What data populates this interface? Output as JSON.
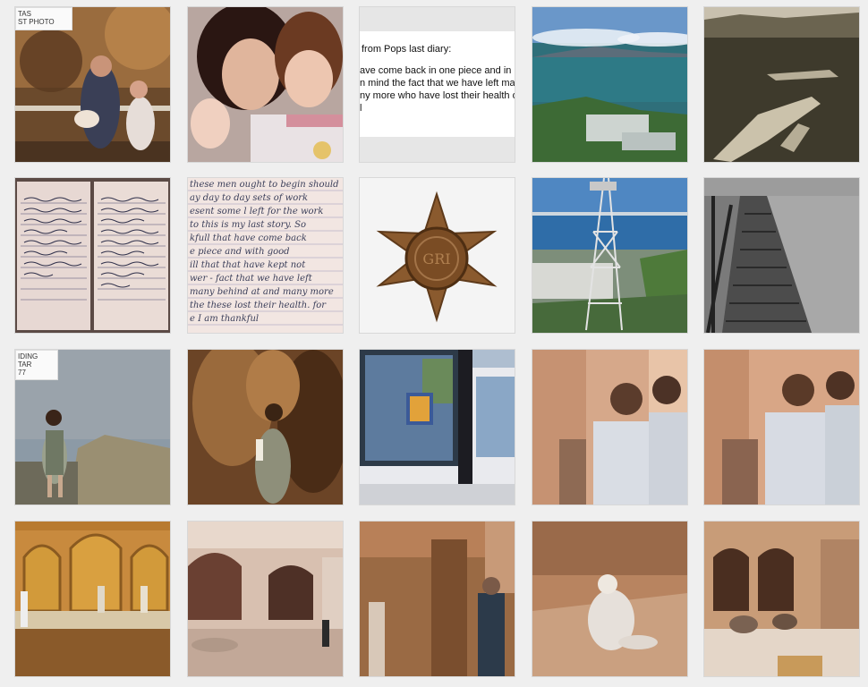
{
  "tiles": [
    {
      "name": "photo-family-garden",
      "note": "TAS\nST PHOTO"
    },
    {
      "name": "photo-mother-children"
    },
    {
      "name": "photo-diary-quote",
      "lines": [
        "from Pops last diary:",
        "ave come back in one piece and in",
        "n mind the fact that we have left ma",
        "ny more who have lost their health o",
        "l"
      ]
    },
    {
      "name": "photo-coast-view"
    },
    {
      "name": "photo-warships-harbor"
    },
    {
      "name": "photo-diary-notebook"
    },
    {
      "name": "photo-diary-page",
      "lines": [
        "these men ought to begin should",
        "ay day to day sets of work",
        "esent some l left for the work",
        "to this is my last story. So",
        "kfull that have come back",
        "e piece and with good",
        "ill that that have kept not",
        "wer - fact that we have left",
        "many behind at and many more",
        "the these lost their health. for",
        "e I am thankful"
      ]
    },
    {
      "name": "photo-war-star-medal"
    },
    {
      "name": "photo-cable-car-pylon"
    },
    {
      "name": "photo-stone-steps"
    },
    {
      "name": "photo-woman-hilltop",
      "note": "IDING\nTAR\n77"
    },
    {
      "name": "photo-woman-cave"
    },
    {
      "name": "photo-shop-window"
    },
    {
      "name": "photo-children-street-1"
    },
    {
      "name": "photo-children-street-2"
    },
    {
      "name": "photo-palace-gates"
    },
    {
      "name": "photo-mosque-courtyard"
    },
    {
      "name": "photo-market-stall"
    },
    {
      "name": "photo-man-sitting"
    },
    {
      "name": "photo-donkeys-square"
    }
  ]
}
